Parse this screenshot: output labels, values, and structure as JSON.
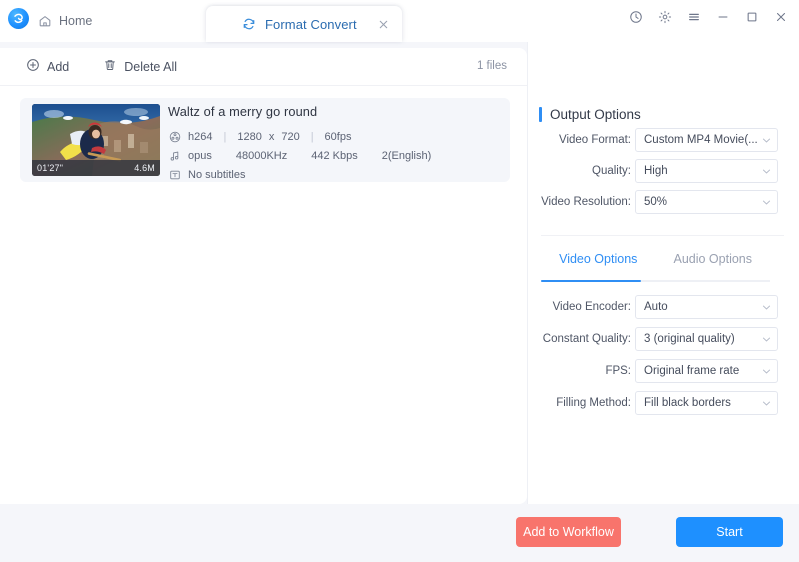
{
  "window": {
    "logo_icon": "app-logo-icon",
    "home_label": "Home",
    "home_icon": "home-icon",
    "controls": {
      "history_icon": "clock-history-icon",
      "settings_icon": "gear-icon",
      "menu_icon": "hamburger-menu-icon",
      "minimize_icon": "minimize-icon",
      "maximize_icon": "maximize-icon",
      "close_icon": "close-icon"
    }
  },
  "tab": {
    "label": "Format Convert",
    "icon": "convert-refresh-icon",
    "close_icon": "close-icon",
    "active_color": "#2b6cb0"
  },
  "toolbar": {
    "add_label": "Add",
    "add_icon": "plus-circle-icon",
    "delete_all_label": "Delete All",
    "delete_all_icon": "trash-icon",
    "file_count": "1 files"
  },
  "file": {
    "title": "Waltz of a merry go round",
    "duration": "01'27\"",
    "size": "4.6M",
    "video_icon": "film-reel-icon",
    "audio_icon": "music-note-icon",
    "subtitle_icon": "subtitle-t-icon",
    "video": {
      "codec": "h264",
      "width": "1280",
      "x": "x",
      "height": "720",
      "fps": "60fps",
      "sep": "|"
    },
    "audio": {
      "codec": "opus",
      "sample_rate": "48000KHz",
      "bitrate": "442 Kbps",
      "channels": "2(English)"
    },
    "subtitles": "No subtitles"
  },
  "output_options": {
    "title": "Output Options",
    "accent_color": "#2f8ef4",
    "fields": [
      {
        "label": "Video Format:",
        "value": "Custom MP4 Movie(..."
      },
      {
        "label": "Quality:",
        "value": "High"
      },
      {
        "label": "Video Resolution:",
        "value": "50%"
      }
    ]
  },
  "option_tabs": [
    {
      "label": "Video Options",
      "active": true
    },
    {
      "label": "Audio Options",
      "active": false
    }
  ],
  "video_options": {
    "fields": [
      {
        "label": "Video Encoder:",
        "value": "Auto"
      },
      {
        "label": "Constant Quality:",
        "value": "3 (original quality)"
      },
      {
        "label": "FPS:",
        "value": "Original frame rate"
      },
      {
        "label": "Filling Method:",
        "value": "Fill black borders"
      }
    ]
  },
  "actions": {
    "workflow_label": "Add to Workflow",
    "workflow_color": "#f8746c",
    "start_label": "Start",
    "start_color": "#1e90ff"
  }
}
